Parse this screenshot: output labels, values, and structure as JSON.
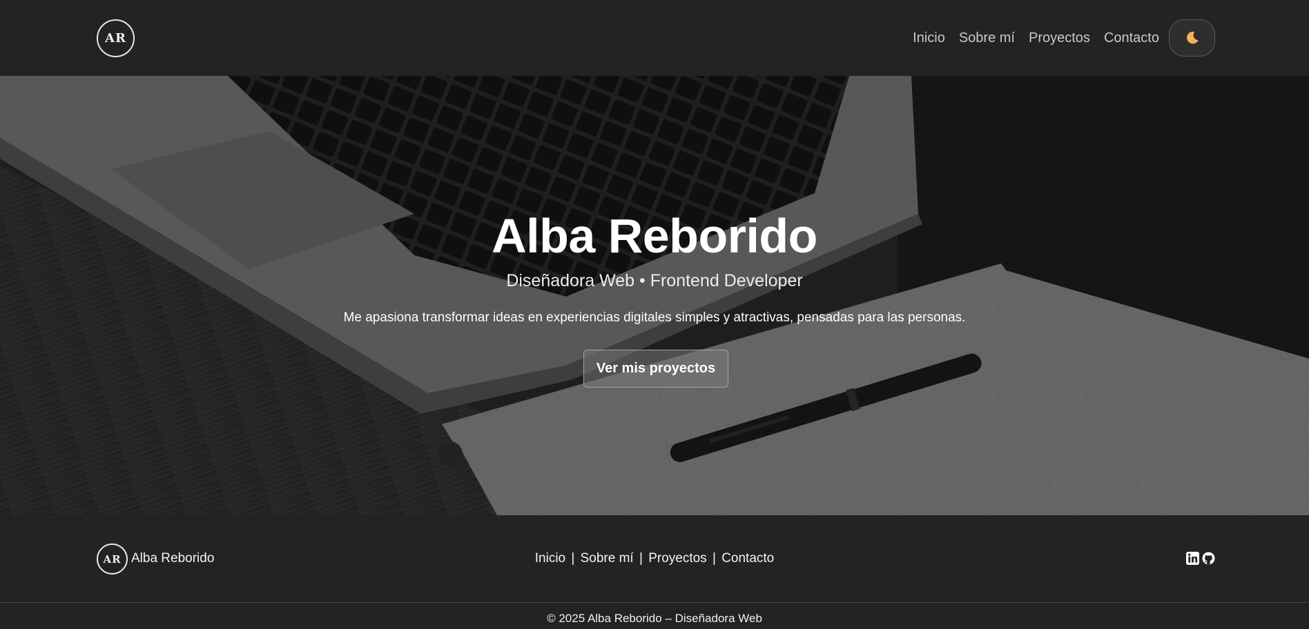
{
  "header": {
    "logo": "AR",
    "nav": [
      "Inicio",
      "Sobre mí",
      "Proyectos",
      "Contacto"
    ],
    "theme_toggle_icon": "moon-icon"
  },
  "hero": {
    "title": "Alba Reborido",
    "subtitle": "Diseñadora Web • Frontend Developer",
    "description": "Me apasiona transformar ideas en experiencias digitales simples y atractivas, pensadas para las personas.",
    "cta_label": "Ver mis proyectos"
  },
  "footer": {
    "logo": "AR",
    "brand": "Alba Reborido",
    "nav": [
      "Inicio",
      "Sobre mí",
      "Proyectos",
      "Contacto"
    ],
    "separator": "|",
    "social_icons": [
      "linkedin-icon",
      "github-icon"
    ],
    "copyright": "© 2025 Alba Reborido – Diseñadora Web"
  },
  "colors": {
    "background": "#232323",
    "moon": "#f2b45c"
  }
}
